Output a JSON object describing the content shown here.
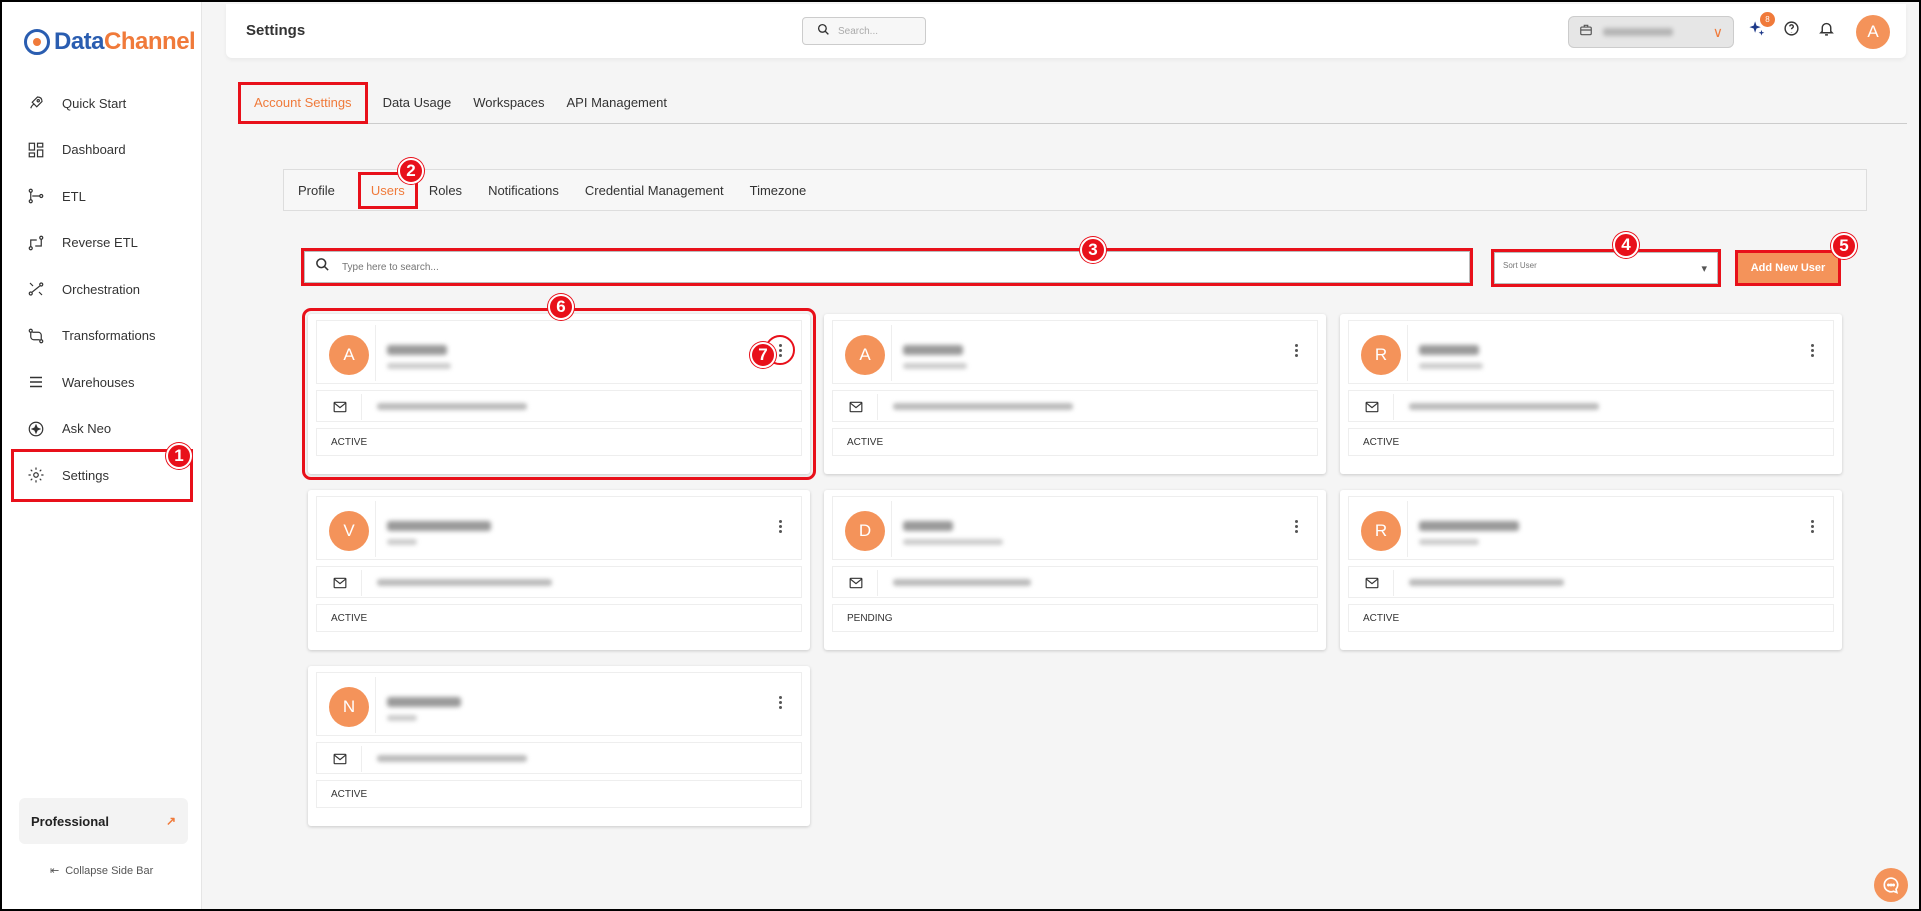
{
  "app": {
    "logo_part1": "Data",
    "logo_part2": "Channel"
  },
  "sidebar": {
    "items": [
      {
        "label": "Quick Start",
        "icon": "rocket-icon"
      },
      {
        "label": "Dashboard",
        "icon": "grid-icon"
      },
      {
        "label": "ETL",
        "icon": "etl-icon"
      },
      {
        "label": "Reverse ETL",
        "icon": "reverse-etl-icon"
      },
      {
        "label": "Orchestration",
        "icon": "orchestration-icon"
      },
      {
        "label": "Transformations",
        "icon": "transform-icon"
      },
      {
        "label": "Warehouses",
        "icon": "warehouse-icon"
      },
      {
        "label": "Ask Neo",
        "icon": "sparkle-icon"
      },
      {
        "label": "Settings",
        "icon": "gear-icon"
      }
    ],
    "plan_label": "Professional",
    "collapse_label": "Collapse Side Bar"
  },
  "header": {
    "title": "Settings",
    "search_placeholder": "Search...",
    "notification_count": "8",
    "avatar_initial": "A"
  },
  "main_tabs": [
    "Account Settings",
    "Data Usage",
    "Workspaces",
    "API Management"
  ],
  "sub_tabs": [
    "Profile",
    "Users",
    "Roles",
    "Notifications",
    "Credential Management",
    "Timezone"
  ],
  "users": {
    "search_placeholder": "Type here to search...",
    "sort_placeholder": "Sort User",
    "add_button": "Add New User",
    "cards": [
      {
        "initial": "A",
        "status": "ACTIVE"
      },
      {
        "initial": "A",
        "status": "ACTIVE"
      },
      {
        "initial": "R",
        "status": "ACTIVE"
      },
      {
        "initial": "V",
        "status": "ACTIVE"
      },
      {
        "initial": "D",
        "status": "PENDING"
      },
      {
        "initial": "R",
        "status": "ACTIVE"
      },
      {
        "initial": "N",
        "status": "ACTIVE"
      }
    ]
  },
  "callouts": [
    "1",
    "2",
    "3",
    "4",
    "5",
    "6",
    "7"
  ],
  "colors": {
    "accent": "#f07a3a",
    "avatar": "#f4935a",
    "highlight": "#e8101a",
    "brand_blue": "#2a5db0"
  }
}
